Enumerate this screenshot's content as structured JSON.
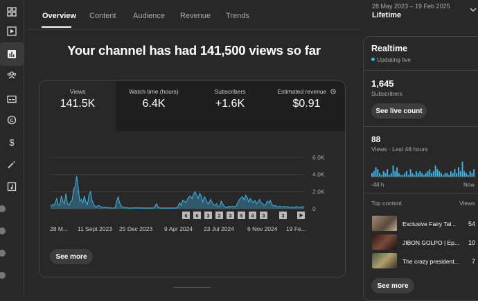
{
  "tabs": [
    {
      "label": "Overview"
    },
    {
      "label": "Content"
    },
    {
      "label": "Audience"
    },
    {
      "label": "Revenue"
    },
    {
      "label": "Trends"
    }
  ],
  "date_range": "28 May 2023 – 19 Feb 2025",
  "period": "Lifetime",
  "headline": "Your channel has had 141,500 views so far",
  "metrics": [
    {
      "label": "Views",
      "value": "141.5K"
    },
    {
      "label": "Watch time (hours)",
      "value": "6.4K"
    },
    {
      "label": "Subscribers",
      "value": "+1.6K"
    },
    {
      "label": "Estimated revenue",
      "value": "$0.91"
    }
  ],
  "chart_data": {
    "type": "area",
    "x_ticks": [
      "28 M...",
      "11 Sept 2023",
      "25 Dec 2023",
      "9 Apr 2024",
      "23 Jul 2024",
      "6 Nov 2024",
      "19 Fe..."
    ],
    "y_ticks": [
      "6.0K",
      "4.0K",
      "2.0K",
      "0"
    ],
    "ylim": [
      0,
      6000
    ],
    "grid": true,
    "markers": [
      "6",
      "6",
      "3",
      "2",
      "3",
      "5",
      "4",
      "3",
      "3"
    ],
    "series": [
      {
        "color": "#41b4e6",
        "values": [
          300,
          500,
          400,
          700,
          1200,
          500,
          400,
          1500,
          900,
          600,
          1800,
          600,
          400,
          800,
          1000,
          2300,
          2600,
          3800,
          2500,
          900,
          1100,
          700,
          1500,
          800,
          500,
          1600,
          2000,
          1000,
          500,
          300,
          200,
          400,
          300,
          200,
          150,
          200,
          150,
          100,
          120,
          100,
          90,
          80,
          100,
          900,
          1400,
          700,
          300,
          200,
          150,
          120,
          100,
          100,
          90,
          80,
          100,
          120,
          100,
          90,
          110,
          100,
          90,
          80,
          100,
          90,
          80,
          100,
          90,
          80,
          300,
          600,
          200,
          100,
          90,
          80,
          100,
          90,
          80,
          100,
          90,
          80,
          100,
          90,
          80,
          300,
          700,
          400,
          1000,
          900,
          700,
          1100,
          1400,
          1500,
          1200,
          1700,
          2000,
          1600,
          1200,
          1800,
          1500,
          800,
          1400,
          1200,
          700,
          600,
          1100,
          800,
          500,
          400,
          600,
          300,
          200,
          900,
          600,
          300,
          200,
          150,
          300,
          200,
          300,
          250,
          200,
          400,
          800,
          1100,
          1300,
          1400,
          1000,
          1600,
          1300,
          800,
          1200,
          900,
          700,
          1000,
          600,
          800,
          1100,
          700,
          600,
          400,
          500,
          900,
          700,
          1000,
          500,
          300,
          400,
          300,
          200,
          300,
          250,
          200,
          300,
          200,
          250,
          200,
          150,
          200,
          150,
          200,
          250,
          200,
          150,
          200,
          250,
          200
        ]
      }
    ]
  },
  "see_more_label": "See more",
  "realtime": {
    "title": "Realtime",
    "status": "Updating live",
    "subscribers_value": "1,645",
    "subscribers_label": "Subscribers",
    "see_live_count": "See live count",
    "views_value": "88",
    "views_label": "Views · Last 48 hours",
    "bars": [
      2,
      3,
      5,
      4,
      2,
      1,
      3,
      2,
      4,
      1,
      2,
      6,
      3,
      5,
      2,
      1,
      1,
      2,
      3,
      1,
      4,
      2,
      1,
      3,
      2,
      3,
      2,
      1,
      2,
      3,
      4,
      2,
      3,
      6,
      4,
      3,
      2,
      1,
      2,
      2,
      1,
      3,
      2,
      4,
      2,
      5,
      3,
      8,
      3,
      2,
      1,
      3,
      2,
      4
    ],
    "axis_left": "-48 h",
    "axis_right": "Now",
    "top_content_label": "Top content",
    "top_content_col": "Views",
    "top_content": [
      {
        "title": "Exclusive Fairy Tal...",
        "views": "54"
      },
      {
        "title": "JIBON GOLPO | Ep...",
        "views": "10"
      },
      {
        "title": "The crazy president...",
        "views": "7"
      }
    ],
    "see_more_label": "See more"
  }
}
